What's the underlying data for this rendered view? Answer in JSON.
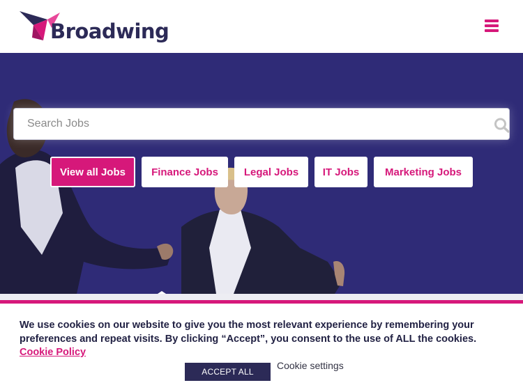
{
  "header": {
    "logo_text": "Broadwing",
    "menu_icon": "hamburger-menu-icon"
  },
  "search": {
    "placeholder": "Search Jobs",
    "value": "",
    "icon": "search-icon"
  },
  "job_links": [
    {
      "label": "View all Jobs",
      "active": true
    },
    {
      "label": "Finance Jobs",
      "active": false
    },
    {
      "label": "Legal Jobs",
      "active": false
    },
    {
      "label": "IT Jobs",
      "active": false
    },
    {
      "label": "Marketing Jobs",
      "active": false
    }
  ],
  "cookie": {
    "message": "We use cookies on our website to give you the most relevant experience by remembering your preferences and repeat visits. By clicking “Accept”, you consent to the use of ALL the cookies.",
    "policy_link": "Cookie Policy",
    "accept_label": "ACCEPT ALL",
    "settings_label": "Cookie settings"
  },
  "colors": {
    "brand_pink": "#d6187a",
    "brand_navy": "#2c2a57",
    "hero_bg": "#2f2b77"
  }
}
